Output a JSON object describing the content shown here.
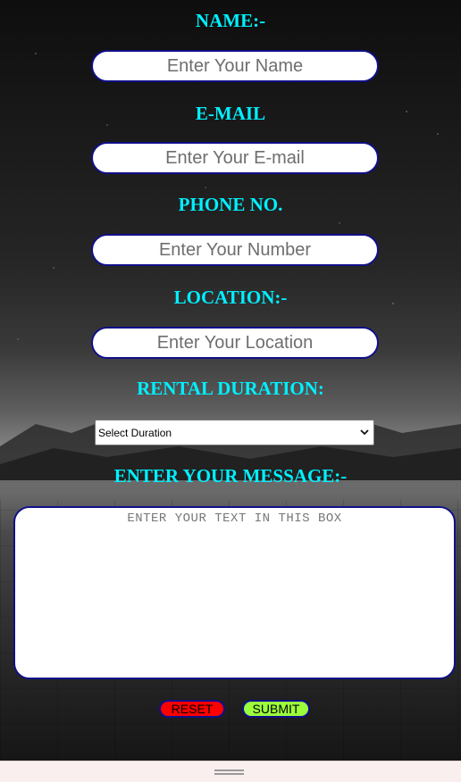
{
  "form": {
    "name_label": "NAME:-",
    "name_placeholder": "Enter Your Name",
    "email_label": "E-MAIL",
    "email_placeholder": "Enter Your E-mail",
    "phone_label": "PHONE NO.",
    "phone_placeholder": "Enter Your Number",
    "location_label": "LOCATION:-",
    "location_placeholder": "Enter Your Location",
    "duration_label": "RENTAL DURATION:",
    "duration_selected": "Select Duration",
    "message_label": "ENTER YOUR MESSAGE:-",
    "message_placeholder": "ENTER YOUR TEXT IN THIS BOX"
  },
  "buttons": {
    "reset_label": "RESET",
    "submit_label": "SUBMIT"
  },
  "colors": {
    "label": "#00f0ff",
    "input_border": "#10108a",
    "reset_bg": "#ff0000",
    "submit_bg": "#9bff3c"
  }
}
